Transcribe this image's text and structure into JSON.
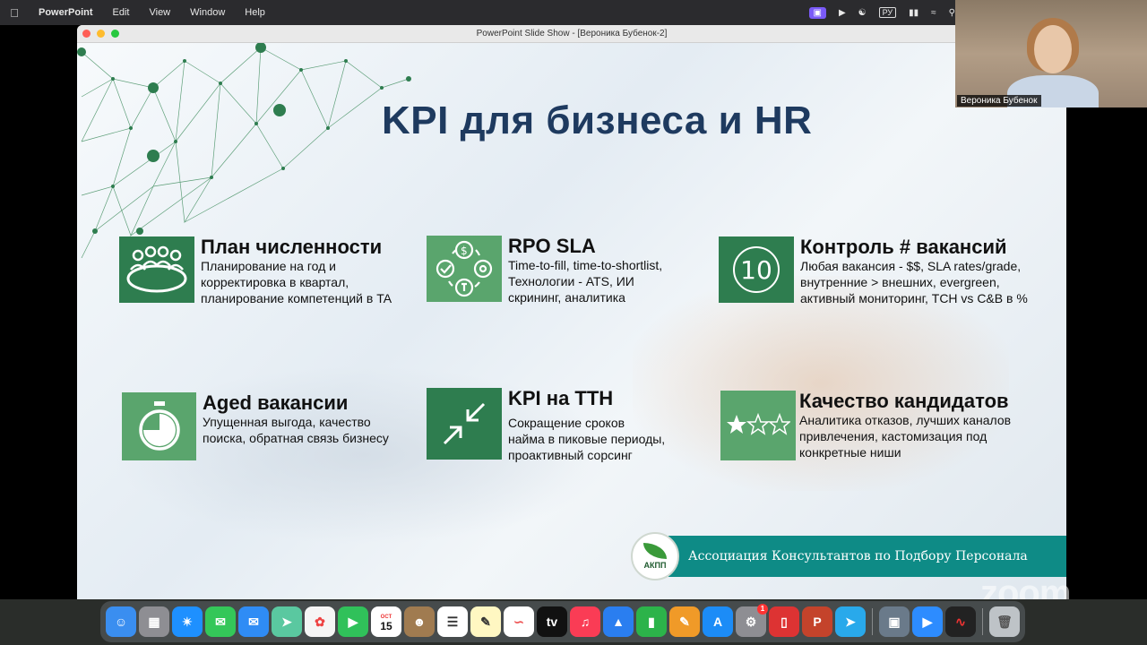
{
  "menubar": {
    "apple": "",
    "app": "PowerPoint",
    "items": [
      "Edit",
      "View",
      "Window",
      "Help"
    ],
    "lang": "РУ"
  },
  "window": {
    "title": "PowerPoint Slide Show - [Вероника Бубенок-2]"
  },
  "slide": {
    "title": "KPI для бизнеса и HR",
    "cards": [
      {
        "head": "План численности",
        "body": "Планирование на год и\nкорректировка в квартал,\nпланирование компетенций в TA",
        "icon": "meeting-table-icon"
      },
      {
        "head": "RPO SLA",
        "body": "Time-to-fill, time-to-shortlist,\nТехнологии - ATS, ИИ\nскрининг, аналитика",
        "icon": "process-cycle-icon"
      },
      {
        "head": "Контроль # вакансий",
        "body": "Любая вакансия - $$, SLA rates/grade,\nвнутренние > внешних, evergreen,\nактивный мониторинг, TCH vs C&B в %",
        "icon": "number-ten-icon",
        "icon_text": "10"
      },
      {
        "head": "Aged вакансии",
        "body": "Упущенная выгода, качество\nпоиска, обратная связь бизнесу",
        "icon": "stopwatch-icon"
      },
      {
        "head": "KPI на TTH",
        "body": "Сокращение сроков\nнайма в пиковые периоды,\nпроактивный сорсинг",
        "icon": "compress-arrows-icon"
      },
      {
        "head": "Качество кандидатов",
        "body": "Аналитика отказов, лучших каналов\nпривлечения, кастомизация под\nконкретные ниши",
        "icon": "star-rating-icon"
      }
    ],
    "footer": {
      "logo_abbr": "АКПП",
      "association": "Ассоциация Консультантов по Подбору Персонала"
    }
  },
  "participant": {
    "name": "Вероника Бубенок"
  },
  "zoom_logo": "zoom",
  "dock": {
    "calendar_month": "OCT",
    "calendar_day": "15",
    "badge": "1"
  },
  "colors": {
    "icon_dark": "#2e7d4f",
    "icon_light": "#5aa56d",
    "title": "#1e3a5f",
    "banner": "#0e8b86"
  }
}
